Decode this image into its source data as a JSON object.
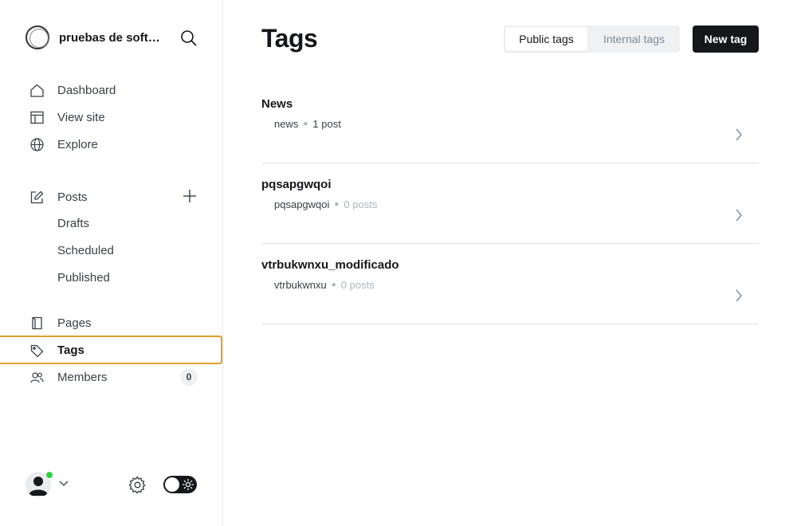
{
  "brand": {
    "title": "pruebas de software"
  },
  "nav": {
    "dashboard": "Dashboard",
    "view_site": "View site",
    "explore": "Explore",
    "posts": "Posts",
    "drafts": "Drafts",
    "scheduled": "Scheduled",
    "published": "Published",
    "pages": "Pages",
    "tags": "Tags",
    "members": "Members",
    "members_count": "0"
  },
  "header": {
    "title": "Tags",
    "tab_public": "Public tags",
    "tab_internal": "Internal tags",
    "new_tag_label": "New tag",
    "active_tab": "Public tags"
  },
  "tags": [
    {
      "name": "News",
      "slug": "news",
      "count": "1 post"
    },
    {
      "name": "pqsapgwqoi",
      "slug": "pqsapgwqoi",
      "count": "0 posts"
    },
    {
      "name": "vtrbukwnxu_modificado",
      "slug": "vtrbukwnxu",
      "count": "0 posts"
    }
  ],
  "colors": {
    "accent_active_border": "#e59e2d",
    "status_online": "#30cf43",
    "primary_button": "#15171a"
  },
  "icons": [
    "search-icon",
    "home-icon",
    "view-site-icon",
    "globe-icon",
    "edit-icon",
    "plus-icon",
    "pages-icon",
    "tag-icon",
    "members-icon",
    "gear-icon",
    "sun-icon",
    "chevron-right-icon",
    "chevron-down-icon"
  ]
}
